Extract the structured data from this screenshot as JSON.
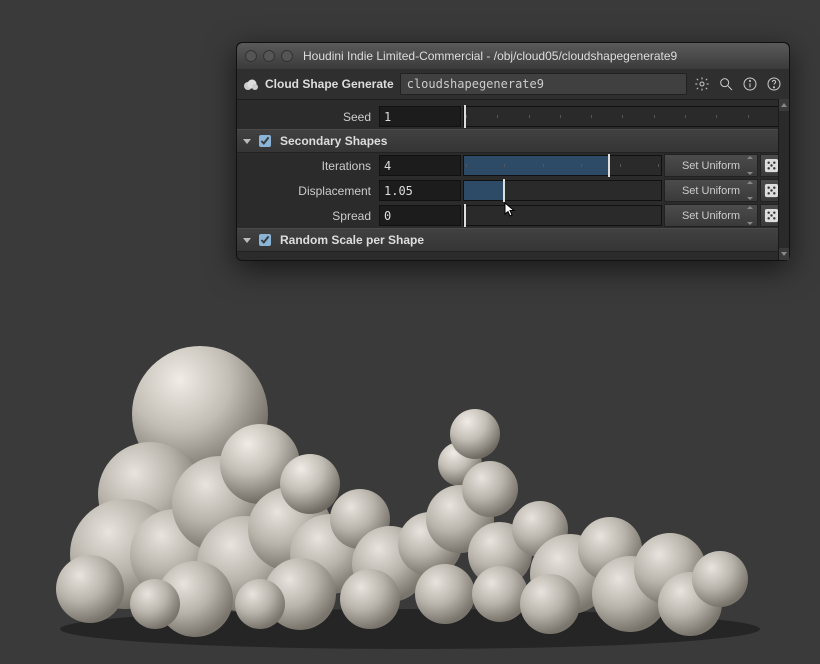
{
  "window": {
    "title": "Houdini Indie Limited-Commercial - /obj/cloud05/cloudshapegenerate9"
  },
  "node": {
    "type_label": "Cloud Shape Generate",
    "name": "cloudshapegenerate9"
  },
  "params": {
    "seed": {
      "label": "Seed",
      "value": "1",
      "slider_pct": 0
    },
    "iterations": {
      "label": "Iterations",
      "value": "4",
      "slider_pct": 73,
      "menu": "Set Uniform"
    },
    "displacement": {
      "label": "Displacement",
      "value": "1.05",
      "slider_pct": 20,
      "menu": "Set Uniform"
    },
    "spread": {
      "label": "Spread",
      "value": "0",
      "slider_pct": 0,
      "menu": "Set Uniform"
    }
  },
  "sections": {
    "secondary_shapes": {
      "label": "Secondary Shapes",
      "checked": true
    },
    "random_scale": {
      "label": "Random Scale per Shape",
      "checked": true
    }
  },
  "colors": {
    "panel_bg": "#2b2b2b",
    "slider_fill": "#2d4a66"
  }
}
